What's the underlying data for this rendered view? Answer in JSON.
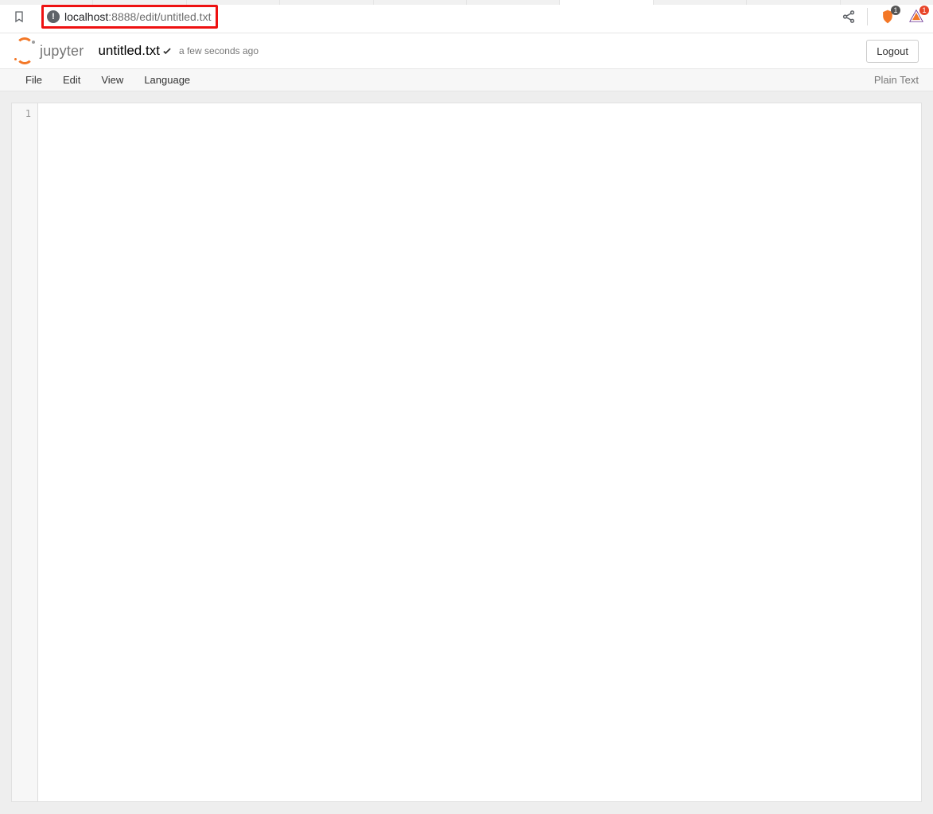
{
  "browser": {
    "url_host": "localhost",
    "url_path": ":8888/edit/untitled.txt",
    "ext1_badge": "1",
    "ext2_badge": "1"
  },
  "header": {
    "logo_text": "jupyter",
    "filename": "untitled.txt",
    "last_saved": "a few seconds ago",
    "logout_label": "Logout"
  },
  "menubar": {
    "items": [
      "File",
      "Edit",
      "View",
      "Language"
    ],
    "mode_label": "Plain Text"
  },
  "editor": {
    "line_numbers": [
      "1"
    ],
    "content": ""
  }
}
